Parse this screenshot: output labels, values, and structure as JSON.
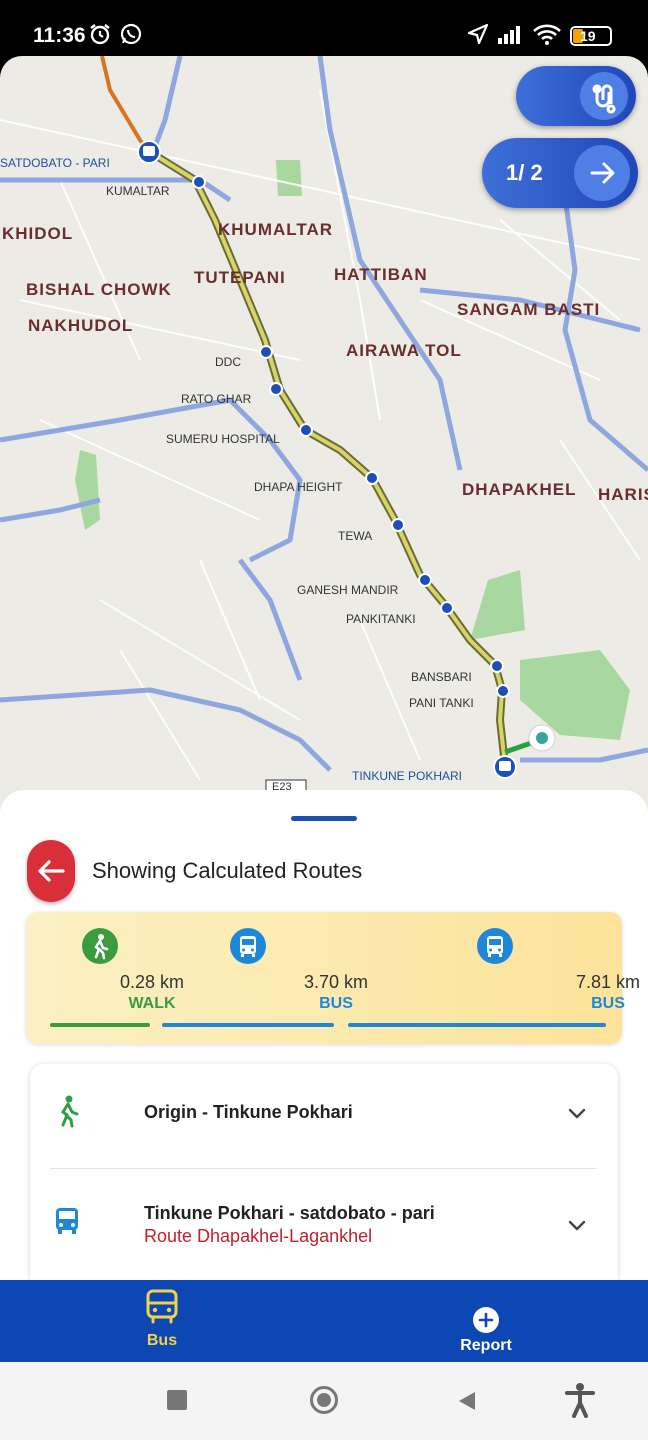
{
  "status_bar": {
    "time": "11:36",
    "battery": "19",
    "icons": [
      "alarm-icon",
      "whatsapp-icon",
      "location-arrow-icon",
      "signal-icon",
      "wifi-icon",
      "battery-icon"
    ]
  },
  "map": {
    "area_labels": [
      "KHUMALTAR",
      "TUTEPANI",
      "HATTIBAN",
      "KHIDOL",
      "BISHAL CHOWK",
      "NAKHUDOL",
      "SANGAM BASTI",
      "AIRAWA TOL",
      "DHAPAKHEL",
      "HARIS"
    ],
    "place_labels": [
      "KUMALTAR",
      "DDC",
      "RATO GHAR",
      "SUMERU HOSPITAL",
      "DHAPA HEIGHT",
      "TEWA",
      "GANESH MANDIR",
      "PANKITANKI",
      "BANSBARI",
      "PANI TANKI",
      "E23"
    ],
    "stop_labels": [
      "SATDOBATO - PARI",
      "TINKUNE POKHARI"
    ],
    "pager": "1/ 2",
    "colors": {
      "route": "#c9c04a",
      "walk": "#2e9e44",
      "fab": "#2b57c8"
    }
  },
  "sheet": {
    "title": "Showing Calculated Routes",
    "summary": [
      {
        "distance": "0.28 km",
        "mode": "WALK",
        "icon": "walk-icon",
        "color": "#3a9b3f"
      },
      {
        "distance": "3.70 km",
        "mode": "BUS",
        "icon": "bus-icon",
        "color": "#1e88d8"
      },
      {
        "distance": "7.81 km",
        "mode": "BUS",
        "icon": "bus-icon",
        "color": "#1e88d8"
      }
    ],
    "legs": [
      {
        "title": "Origin - Tinkune Pokhari",
        "subtitle": "",
        "icon": "walk-icon"
      },
      {
        "title": "Tinkune Pokhari - satdobato - pari",
        "subtitle": "Route Dhapakhel-Lagankhel",
        "icon": "bus-icon"
      }
    ]
  },
  "bottom_nav": {
    "items": [
      {
        "label": "Bus",
        "icon": "bus-icon",
        "active": true
      },
      {
        "label": "Report",
        "icon": "plus-circle-icon",
        "active": false
      }
    ]
  }
}
